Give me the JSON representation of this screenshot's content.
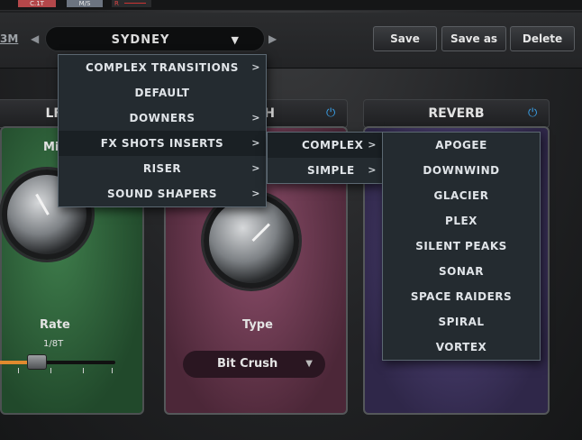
{
  "top": {
    "btn1": "C.1T",
    "btn2": "M/S",
    "btn3": "R"
  },
  "header": {
    "logo_fragment": "3M",
    "preset_name": "SYDNEY",
    "save_label": "Save",
    "save_as_label": "Save as",
    "delete_label": "Delete"
  },
  "modules": {
    "lfo": {
      "title": "LF",
      "knob_label": "Mi",
      "param_label": "Rate",
      "param_value": "1/8T"
    },
    "crush": {
      "title": "CH",
      "param_label": "Type",
      "type_value": "Bit Crush"
    },
    "reverb": {
      "title": "REVERB"
    }
  },
  "menu_level1": [
    {
      "label": "COMPLEX TRANSITIONS",
      "has_sub": true
    },
    {
      "label": "DEFAULT",
      "has_sub": false
    },
    {
      "label": "DOWNERS",
      "has_sub": true
    },
    {
      "label": "FX SHOTS INSERTS",
      "has_sub": true,
      "active": true
    },
    {
      "label": "RISER",
      "has_sub": true
    },
    {
      "label": "SOUND SHAPERS",
      "has_sub": true
    }
  ],
  "menu_level2": [
    {
      "label": "COMPLEX",
      "has_sub": true
    },
    {
      "label": "SIMPLE",
      "has_sub": true
    }
  ],
  "menu_level3": [
    "APOGEE",
    "DOWNWIND",
    "GLACIER",
    "PLEX",
    "SILENT PEAKS",
    "SONAR",
    "SPACE RAIDERS",
    "SPIRAL",
    "VORTEX"
  ],
  "colors": {
    "power_icon": "#3aa0e8",
    "lfo_accent": "#e08a2e"
  }
}
